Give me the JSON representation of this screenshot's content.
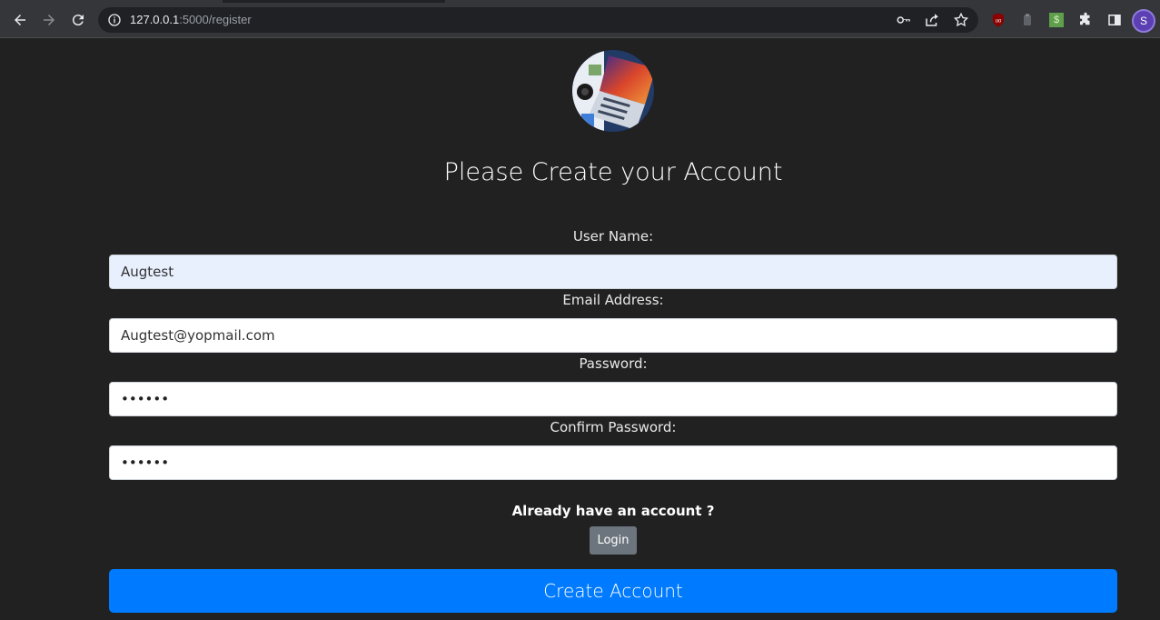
{
  "browser": {
    "url_host": "127.0.0.1",
    "url_path": ":5000/register",
    "profile_initial": "S",
    "icons": {
      "back": "back-arrow-icon",
      "forward": "forward-arrow-icon",
      "reload": "reload-icon",
      "info": "info-icon",
      "key": "key-icon",
      "share": "share-icon",
      "bookmark": "star-icon",
      "ublock": "ublock-icon",
      "ext2": "extension-icon",
      "ext3": "dollar-extension-icon",
      "extensions": "puzzle-icon",
      "sidepanel": "side-panel-icon"
    },
    "ext3_label": "$"
  },
  "page": {
    "title": "Please Create your Account",
    "fields": [
      {
        "label": "User Name:",
        "value": "Augtest"
      },
      {
        "label": "Email Address:",
        "value": "Augtest@yopmail.com"
      },
      {
        "label": "Password:",
        "value": "••••••"
      },
      {
        "label": "Confirm Password:",
        "value": "••••••"
      }
    ],
    "already_text": "Already have an account ?",
    "login_label": "Login",
    "create_label": "Create Account"
  },
  "colors": {
    "background": "#212121",
    "primary_button": "#007bff",
    "secondary_button": "#6c757d",
    "autofill": "#e8f0fe"
  }
}
